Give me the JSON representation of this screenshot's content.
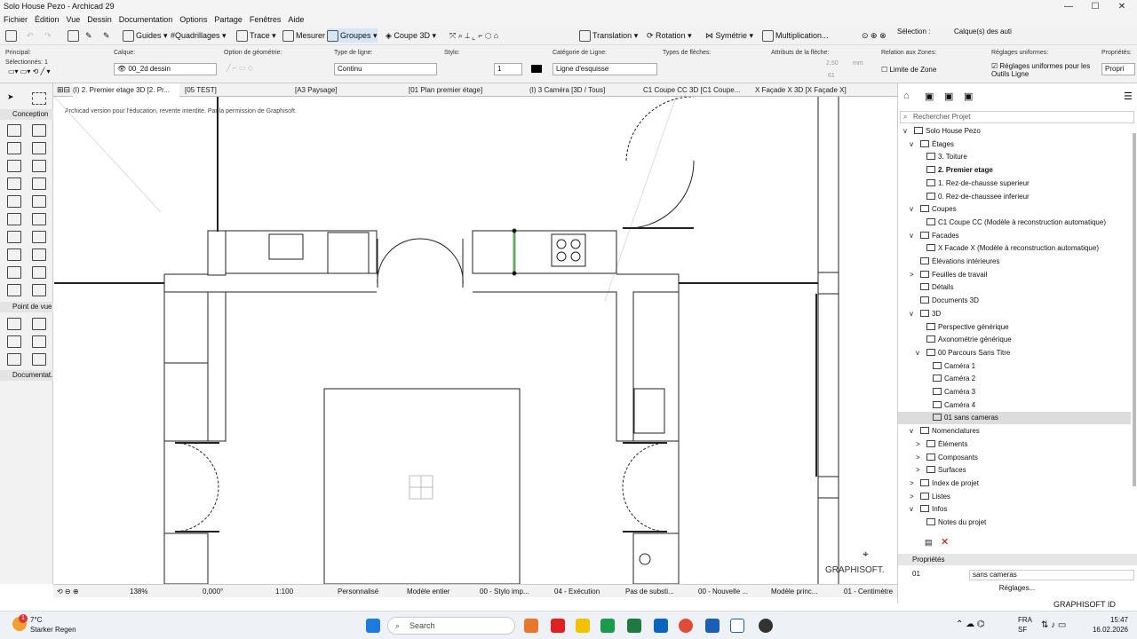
{
  "window": {
    "title": "Solo House Pezo - Archicad 29"
  },
  "menu": [
    "Fichier",
    "Édition",
    "Vue",
    "Dessin",
    "Documentation",
    "Options",
    "Partage",
    "Fenêtres",
    "Aide"
  ],
  "toolbar": {
    "guides": "Guides",
    "quadrillages": "Quadrillages",
    "trace": "Trace",
    "mesurer": "Mesurer",
    "groupes": "Groupes",
    "coupe3d": "Coupe 3D",
    "translation": "Translation",
    "rotation": "Rotation",
    "symetrie": "Symétrie",
    "multiplication": "Multiplication...",
    "selection": "Sélection :",
    "calques": "Calque(s) des auti"
  },
  "infobox": {
    "principal": "Principal:",
    "selectionnes": "Sélectionnés: 1",
    "calque_lbl": "Calque:",
    "calque_val": "00_2d dessin",
    "geom_lbl": "Option de géométrie:",
    "type_ligne_lbl": "Type de ligne:",
    "type_ligne_val": "Continu",
    "stylo_lbl": "Stylo:",
    "stylo_val": "1",
    "cat_lbl": "Catégorie de Ligne:",
    "cat_val": "Ligne d'esquisse",
    "fleches_lbl": "Types de flèches:",
    "attr_lbl": "Attributs de la flèche:",
    "attr_v1": "2,50",
    "attr_v2": "61",
    "attr_unit": "mm",
    "zones_lbl": "Relation aux Zones:",
    "zones_val": "Limite de Zone",
    "reglages_lbl": "Réglages uniformes:",
    "reglages_val": "Réglages uniformes pour les Outils Ligne",
    "prop_lbl": "Propriétés:",
    "prop_val": "Propri"
  },
  "tabs": [
    "(I) 2. Premier etage 3D [2. Pr...",
    "[05 TEST]",
    "[A3 Paysage]",
    "[01 Plan premier étage]",
    "(I) 3 Caméra [3D / Tous]",
    "C1 Coupe CC 3D [C1 Coupe...",
    "X Façade X 3D [X Façade X]"
  ],
  "toolbox": {
    "conception": "Conception",
    "point_de_vue": "Point de vue",
    "documentation": "Documentat."
  },
  "canvas": {
    "watermark": "Archicad version pour l'éducation, revente interdite. Par la permission de Graphisoft.",
    "brand": "GRAPHISOFT."
  },
  "navigator": {
    "search_placeholder": "Rechercher Projet",
    "rows": [
      {
        "label": "Solo House Pezo",
        "indent": 0,
        "exp": "v",
        "bold": false
      },
      {
        "label": "Étages",
        "indent": 1,
        "exp": "v",
        "bold": false
      },
      {
        "label": "3. Toiture",
        "indent": 2,
        "exp": "",
        "bold": false
      },
      {
        "label": "2. Premier etage",
        "indent": 2,
        "exp": "",
        "bold": true
      },
      {
        "label": "1. Rez-de-chausse superieur",
        "indent": 2,
        "exp": "",
        "bold": false
      },
      {
        "label": "0. Rez-de-chaussee inferieur",
        "indent": 2,
        "exp": "",
        "bold": false
      },
      {
        "label": "Coupes",
        "indent": 1,
        "exp": "v",
        "bold": false
      },
      {
        "label": "C1 Coupe CC (Modèle à reconstruction automatique)",
        "indent": 2,
        "exp": "",
        "bold": false
      },
      {
        "label": "Facades",
        "indent": 1,
        "exp": "v",
        "bold": false
      },
      {
        "label": "X Facade X (Modèle à reconstruction automatique)",
        "indent": 2,
        "exp": "",
        "bold": false
      },
      {
        "label": "Élévations intérieures",
        "indent": 1,
        "exp": "",
        "bold": false
      },
      {
        "label": "Feuilles de travail",
        "indent": 1,
        "exp": ">",
        "bold": false
      },
      {
        "label": "Détails",
        "indent": 1,
        "exp": "",
        "bold": false
      },
      {
        "label": "Documents 3D",
        "indent": 1,
        "exp": "",
        "bold": false
      },
      {
        "label": "3D",
        "indent": 1,
        "exp": "v",
        "bold": false
      },
      {
        "label": "Perspective générique",
        "indent": 2,
        "exp": "",
        "bold": false
      },
      {
        "label": "Axonométrie générique",
        "indent": 2,
        "exp": "",
        "bold": false
      },
      {
        "label": "00 Parcours Sans Titre",
        "indent": 2,
        "exp": "v",
        "bold": false
      },
      {
        "label": "Caméra 1",
        "indent": 3,
        "exp": "",
        "bold": false
      },
      {
        "label": "Caméra 2",
        "indent": 3,
        "exp": "",
        "bold": false
      },
      {
        "label": "Caméra 3",
        "indent": 3,
        "exp": "",
        "bold": false
      },
      {
        "label": "Caméra 4",
        "indent": 3,
        "exp": "",
        "bold": false
      },
      {
        "label": "01 sans cameras",
        "indent": 3,
        "exp": "",
        "bold": false,
        "selected": true
      },
      {
        "label": "Nomenclatures",
        "indent": 1,
        "exp": "v",
        "bold": false
      },
      {
        "label": "Éléments",
        "indent": 2,
        "exp": ">",
        "bold": false
      },
      {
        "label": "Composants",
        "indent": 2,
        "exp": ">",
        "bold": false
      },
      {
        "label": "Surfaces",
        "indent": 2,
        "exp": ">",
        "bold": false
      },
      {
        "label": "Index de projet",
        "indent": 1,
        "exp": ">",
        "bold": false
      },
      {
        "label": "Listes",
        "indent": 1,
        "exp": ">",
        "bold": false
      },
      {
        "label": "Infos",
        "indent": 1,
        "exp": "v",
        "bold": false
      },
      {
        "label": "Notes du projet",
        "indent": 2,
        "exp": "",
        "bold": false
      }
    ],
    "proprietes": "Propriétés",
    "prop_id": "01",
    "prop_val": "sans cameras",
    "reglages": "Réglages..."
  },
  "statusbar": {
    "zoom": "138%",
    "angle": "0,000°",
    "scale": "1:100",
    "perso": "Personnalisé",
    "modele": "Modèle entier",
    "stylo": "00 - Stylo imp...",
    "execution": "04 - Exécution",
    "pas": "Pas de substi...",
    "nouvelle": "00 - Nouvelle ...",
    "princ": "Modèle princ...",
    "unit": "01 - Centimètre"
  },
  "graphisoft_id": "GRAPHISOFT ID",
  "taskbar": {
    "temp": "7°C",
    "weather": "Starker Regen",
    "badge": "1",
    "search": "Search",
    "lang1": "FRA",
    "lang2": "SF",
    "time": "15:47",
    "date": "16.02.2026"
  }
}
